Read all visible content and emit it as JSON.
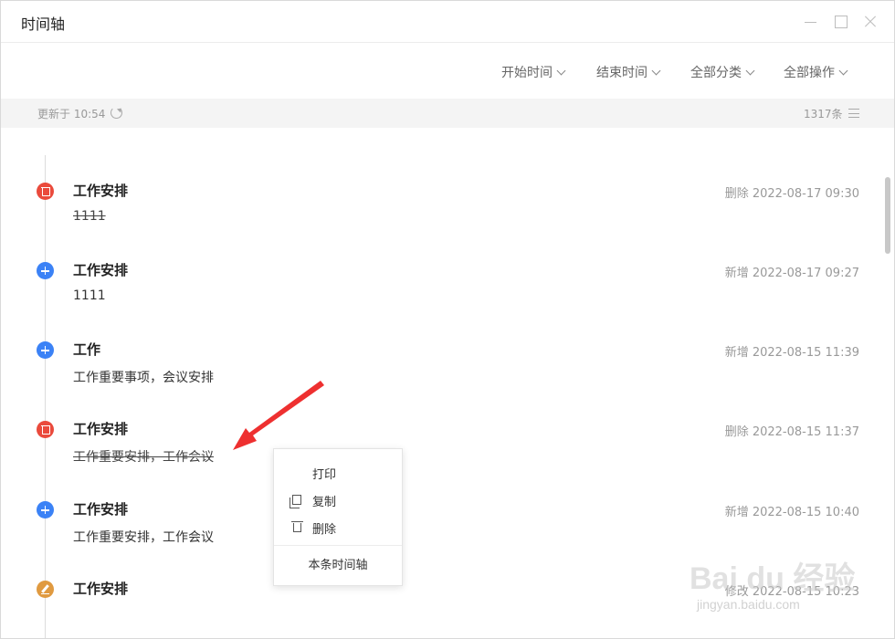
{
  "window": {
    "title": "时间轴"
  },
  "filters": {
    "start_time": "开始时间",
    "end_time": "结束时间",
    "category": "全部分类",
    "operation": "全部操作"
  },
  "status": {
    "updated": "更新于 10:54",
    "count": "1317条"
  },
  "timeline": [
    {
      "type": "delete",
      "icon": "trash-icon",
      "title": "工作安排",
      "content": "1111",
      "meta": "删除 2022-08-17 09:30"
    },
    {
      "type": "add",
      "icon": "plus-icon",
      "title": "工作安排",
      "content": "1111",
      "meta": "新增 2022-08-17 09:27"
    },
    {
      "type": "add",
      "icon": "plus-icon",
      "title": "工作",
      "content": "工作重要事项，会议安排",
      "meta": "新增 2022-08-15 11:39"
    },
    {
      "type": "delete",
      "icon": "trash-icon",
      "title": "工作安排",
      "content": "工作重要安排，工作会议",
      "meta": "删除 2022-08-15 11:37"
    },
    {
      "type": "add",
      "icon": "plus-icon",
      "title": "工作安排",
      "content": "工作重要安排，工作会议",
      "meta": "新增 2022-08-15 10:40"
    },
    {
      "type": "edit",
      "icon": "pencil-icon",
      "title": "工作安排",
      "content": "",
      "meta": "修改 2022-08-15 10:23"
    }
  ],
  "context_menu": {
    "print": "打印",
    "copy": "复制",
    "delete": "删除",
    "this_timeline": "本条时间轴"
  },
  "watermark": {
    "main": "Bai du 经验",
    "sub": "jingyan.baidu.com"
  },
  "colors": {
    "add": "#3b82f6",
    "delete": "#ea4a3c",
    "edit": "#e09a40",
    "annotation_arrow": "#ee3030"
  }
}
